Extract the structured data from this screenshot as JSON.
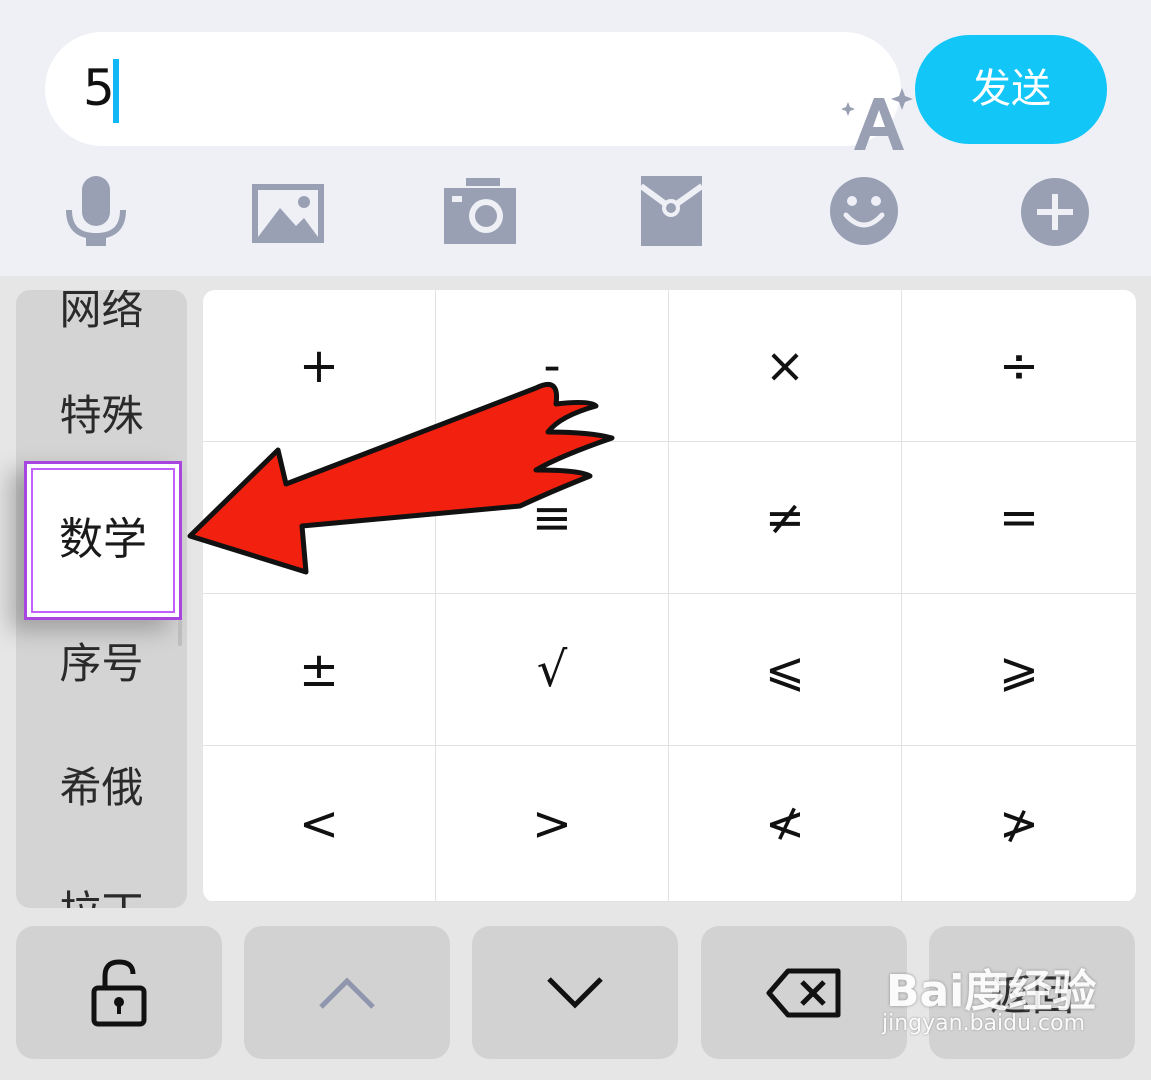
{
  "input": {
    "value": "5"
  },
  "send_label": "发送",
  "toolbar": [
    {
      "icon": "microphone-icon"
    },
    {
      "icon": "image-icon"
    },
    {
      "icon": "camera-icon"
    },
    {
      "icon": "red-packet-icon"
    },
    {
      "icon": "emoji-icon"
    },
    {
      "icon": "plus-icon"
    }
  ],
  "categories": {
    "partial_top": "网络",
    "item1": "特殊",
    "selected": "数学",
    "item3": "序号",
    "item4": "希俄",
    "partial_bottom": "拉丁"
  },
  "symbols": [
    "+",
    "-",
    "×",
    "÷",
    "",
    "≡",
    "≠",
    "=",
    "±",
    "√",
    "⩽",
    "⩾",
    "<",
    ">",
    "≮",
    "≯"
  ],
  "bottom_keys": {
    "lock": "lock-icon",
    "up": "chevron-up-icon",
    "down": "chevron-down-icon",
    "delete": "backspace-icon",
    "return_label": "返回"
  },
  "watermark": {
    "brand": "Bai度经验",
    "url": "jingyan.baidu.com"
  },
  "colors": {
    "accent": "#12c6f7",
    "selection_border": "#a844e0",
    "annotation_arrow": "#f2200f",
    "icon_gray": "#9aa0b4"
  }
}
